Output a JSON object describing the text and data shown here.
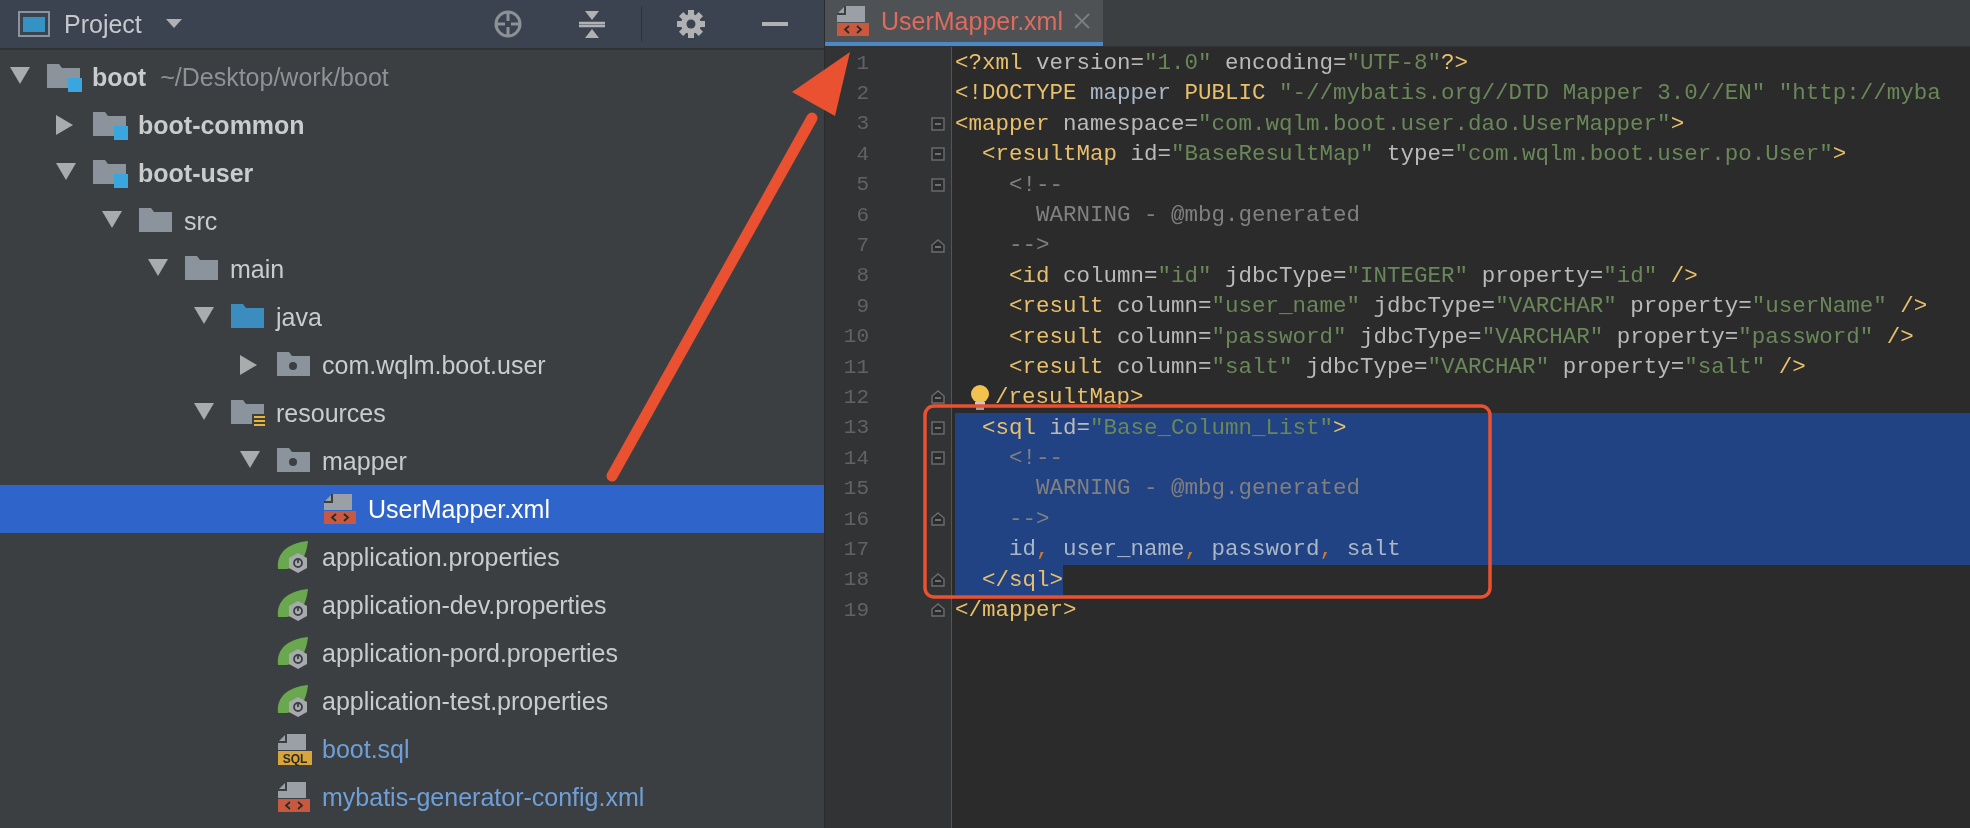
{
  "project_panel": {
    "title": "Project"
  },
  "tree": [
    {
      "label": "boot",
      "suffix": "~/Desktop/work/boot",
      "kind": "module",
      "bold": true,
      "expanded": true,
      "selected": false,
      "children": [
        {
          "label": "boot-common",
          "kind": "module",
          "bold": true,
          "expanded": false,
          "selected": false
        },
        {
          "label": "boot-user",
          "kind": "module",
          "bold": true,
          "expanded": true,
          "selected": false,
          "children": [
            {
              "label": "src",
              "kind": "folder",
              "expanded": true,
              "selected": false,
              "children": [
                {
                  "label": "main",
                  "kind": "folder",
                  "expanded": true,
                  "selected": false,
                  "children": [
                    {
                      "label": "java",
                      "kind": "source",
                      "expanded": true,
                      "selected": false,
                      "children": [
                        {
                          "label": "com.wqlm.boot.user",
                          "kind": "package",
                          "expanded": false,
                          "selected": false
                        }
                      ]
                    },
                    {
                      "label": "resources",
                      "kind": "resources",
                      "expanded": true,
                      "selected": false,
                      "children": [
                        {
                          "label": "mapper",
                          "kind": "package",
                          "expanded": true,
                          "selected": false,
                          "children": [
                            {
                              "label": "UserMapper.xml",
                              "kind": "xml",
                              "selected": true
                            }
                          ]
                        },
                        {
                          "label": "application.properties",
                          "kind": "spring",
                          "selected": false
                        },
                        {
                          "label": "application-dev.properties",
                          "kind": "spring",
                          "selected": false
                        },
                        {
                          "label": "application-pord.properties",
                          "kind": "spring",
                          "selected": false
                        },
                        {
                          "label": "application-test.properties",
                          "kind": "spring",
                          "selected": false
                        },
                        {
                          "label": "boot.sql",
                          "kind": "sql",
                          "badge": "SQL",
                          "color": "#6f9fd8",
                          "selected": false
                        },
                        {
                          "label": "mybatis-generator-config.xml",
                          "kind": "xml",
                          "color": "#6f9fd8",
                          "selected": false
                        }
                      ]
                    }
                  ]
                }
              ]
            }
          ]
        }
      ]
    }
  ],
  "editor": {
    "tabs": [
      {
        "label": "UserMapper.xml",
        "selected": true
      }
    ],
    "lines": [
      {
        "number": "1",
        "fold_start": false,
        "fold_end": false,
        "selected": false,
        "segments": [
          {
            "kind": "tag",
            "text": "<?xml"
          },
          {
            "kind": "attr",
            "text": " version="
          },
          {
            "kind": "value",
            "text": "\"1.0\""
          },
          {
            "kind": "attr",
            "text": " encoding="
          },
          {
            "kind": "value",
            "text": "\"UTF-8\""
          },
          {
            "kind": "tag",
            "text": "?>"
          }
        ]
      },
      {
        "number": "2",
        "fold_start": false,
        "fold_end": false,
        "selected": false,
        "segments": [
          {
            "kind": "tag",
            "text": "<!DOCTYPE"
          },
          {
            "kind": "text",
            "text": " mapper "
          },
          {
            "kind": "tag",
            "text": "PUBLIC"
          },
          {
            "kind": "value",
            "text": " \"-//mybatis.org//DTD Mapper 3.0//EN\""
          },
          {
            "kind": "value",
            "text": " \"http://myba"
          }
        ]
      },
      {
        "number": "3",
        "fold_start": true,
        "fold_end": false,
        "selected": false,
        "segments": [
          {
            "kind": "tag",
            "text": "<mapper"
          },
          {
            "kind": "attr",
            "text": " namespace="
          },
          {
            "kind": "value",
            "text": "\"com.wqlm.boot.user.dao.UserMapper\""
          },
          {
            "kind": "tag",
            "text": ">"
          }
        ]
      },
      {
        "number": "4",
        "fold_start": true,
        "fold_end": false,
        "selected": false,
        "segments": [
          {
            "kind": "tag",
            "text": "  <resultMap"
          },
          {
            "kind": "attr",
            "text": " id="
          },
          {
            "kind": "value",
            "text": "\"BaseResultMap\""
          },
          {
            "kind": "attr",
            "text": " type="
          },
          {
            "kind": "value",
            "text": "\"com.wqlm.boot.user.po.User\""
          },
          {
            "kind": "tag",
            "text": ">"
          }
        ]
      },
      {
        "number": "5",
        "fold_start": true,
        "fold_end": false,
        "selected": false,
        "segments": [
          {
            "kind": "comment",
            "text": "    <!--"
          }
        ]
      },
      {
        "number": "6",
        "fold_start": false,
        "fold_end": false,
        "selected": false,
        "segments": [
          {
            "kind": "comment",
            "text": "      WARNING - @mbg.generated"
          }
        ]
      },
      {
        "number": "7",
        "fold_start": false,
        "fold_end": true,
        "selected": false,
        "segments": [
          {
            "kind": "comment",
            "text": "    -->"
          }
        ]
      },
      {
        "number": "8",
        "fold_start": false,
        "fold_end": false,
        "selected": false,
        "segments": [
          {
            "kind": "tag",
            "text": "    <id"
          },
          {
            "kind": "attr",
            "text": " column="
          },
          {
            "kind": "value",
            "text": "\"id\""
          },
          {
            "kind": "attr",
            "text": " jdbcType="
          },
          {
            "kind": "value",
            "text": "\"INTEGER\""
          },
          {
            "kind": "attr",
            "text": " property="
          },
          {
            "kind": "value",
            "text": "\"id\""
          },
          {
            "kind": "tag",
            "text": " />"
          }
        ]
      },
      {
        "number": "9",
        "fold_start": false,
        "fold_end": false,
        "selected": false,
        "segments": [
          {
            "kind": "tag",
            "text": "    <result"
          },
          {
            "kind": "attr",
            "text": " column="
          },
          {
            "kind": "value",
            "text": "\"user_name\""
          },
          {
            "kind": "attr",
            "text": " jdbcType="
          },
          {
            "kind": "value",
            "text": "\"VARCHAR\""
          },
          {
            "kind": "attr",
            "text": " property="
          },
          {
            "kind": "value",
            "text": "\"userName\""
          },
          {
            "kind": "tag",
            "text": " />"
          }
        ]
      },
      {
        "number": "10",
        "fold_start": false,
        "fold_end": false,
        "selected": false,
        "segments": [
          {
            "kind": "tag",
            "text": "    <result"
          },
          {
            "kind": "attr",
            "text": " column="
          },
          {
            "kind": "value",
            "text": "\"password\""
          },
          {
            "kind": "attr",
            "text": " jdbcType="
          },
          {
            "kind": "value",
            "text": "\"VARCHAR\""
          },
          {
            "kind": "attr",
            "text": " property="
          },
          {
            "kind": "value",
            "text": "\"password\""
          },
          {
            "kind": "tag",
            "text": " />"
          }
        ]
      },
      {
        "number": "11",
        "fold_start": false,
        "fold_end": false,
        "selected": false,
        "segments": [
          {
            "kind": "tag",
            "text": "    <result"
          },
          {
            "kind": "attr",
            "text": " column="
          },
          {
            "kind": "value",
            "text": "\"salt\""
          },
          {
            "kind": "attr",
            "text": " jdbcType="
          },
          {
            "kind": "value",
            "text": "\"VARCHAR\""
          },
          {
            "kind": "attr",
            "text": " property="
          },
          {
            "kind": "value",
            "text": "\"salt\""
          },
          {
            "kind": "tag",
            "text": " />"
          }
        ]
      },
      {
        "number": "12",
        "fold_start": false,
        "fold_end": true,
        "bulb": true,
        "selected": false,
        "segments": [
          {
            "kind": "tag",
            "text": "/resultMap>"
          }
        ]
      },
      {
        "number": "13",
        "fold_start": true,
        "fold_end": false,
        "selected": true,
        "segments": [
          {
            "kind": "tag",
            "text": "  <sql"
          },
          {
            "kind": "attr",
            "text": " id="
          },
          {
            "kind": "value",
            "text": "\"Base_Column_List\""
          },
          {
            "kind": "tag",
            "text": ">"
          }
        ]
      },
      {
        "number": "14",
        "fold_start": true,
        "fold_end": false,
        "selected": true,
        "segments": [
          {
            "kind": "comment",
            "text": "    <!--"
          }
        ]
      },
      {
        "number": "15",
        "fold_start": false,
        "fold_end": false,
        "selected": true,
        "segments": [
          {
            "kind": "comment",
            "text": "      WARNING - @mbg.generated"
          }
        ]
      },
      {
        "number": "16",
        "fold_start": false,
        "fold_end": true,
        "selected": true,
        "segments": [
          {
            "kind": "comment",
            "text": "    -->"
          }
        ]
      },
      {
        "number": "17",
        "fold_start": false,
        "fold_end": false,
        "selected": true,
        "segments": [
          {
            "kind": "text",
            "text": "    id"
          },
          {
            "kind": "punct",
            "text": ","
          },
          {
            "kind": "text",
            "text": " user_name"
          },
          {
            "kind": "punct",
            "text": ","
          },
          {
            "kind": "text",
            "text": " password"
          },
          {
            "kind": "punct",
            "text": ","
          },
          {
            "kind": "text",
            "text": " salt"
          }
        ]
      },
      {
        "number": "18",
        "fold_start": false,
        "fold_end": true,
        "selected": true,
        "segments": [
          {
            "kind": "tag",
            "text": "  </sql>"
          }
        ]
      },
      {
        "number": "19",
        "fold_start": false,
        "fold_end": true,
        "selected": false,
        "segments": [
          {
            "kind": "tag",
            "text": "</mapper>"
          }
        ]
      }
    ]
  }
}
